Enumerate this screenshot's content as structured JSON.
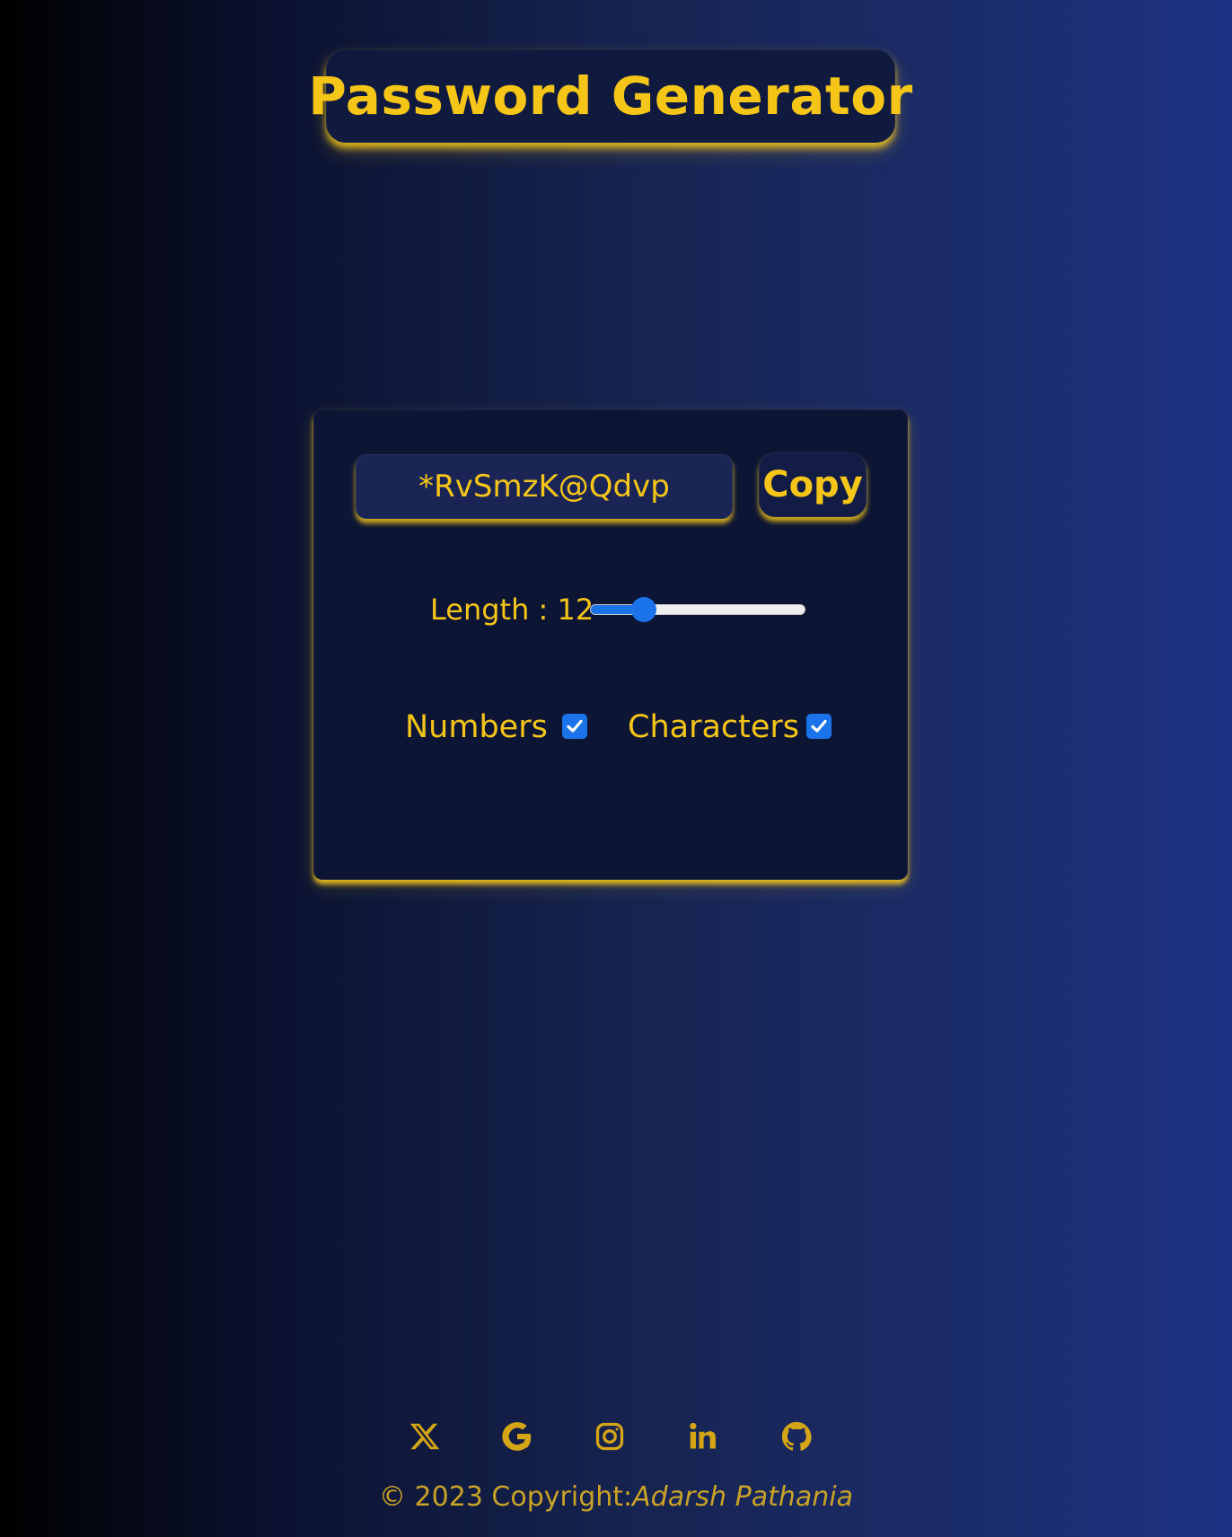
{
  "header": {
    "title": "Password Generator"
  },
  "generator": {
    "password": "*RvSmzK@Qdvp",
    "copy_label": "Copy",
    "length_label": "Length : 12",
    "length_value": 12,
    "length_min": 6,
    "length_max": 30,
    "numbers_label": "Numbers",
    "numbers_checked": true,
    "characters_label": "Characters",
    "characters_checked": true
  },
  "footer": {
    "copyright": "© 2023 Copyright:",
    "author": "Adarsh Pathania",
    "social_icons": [
      "x-icon",
      "google-icon",
      "instagram-icon",
      "linkedin-icon",
      "github-icon"
    ]
  },
  "colors": {
    "accent": "#f5c518",
    "slider_blue": "#1a73e8",
    "card_bg": "#0d1535"
  }
}
